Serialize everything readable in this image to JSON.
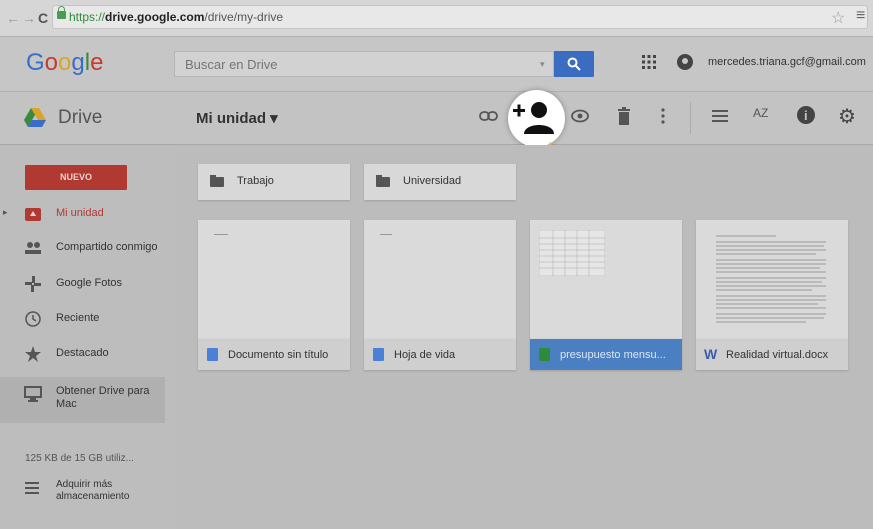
{
  "browser": {
    "url_scheme": "https://",
    "url_host": "drive.google.com",
    "url_path": "/drive/my-drive"
  },
  "header": {
    "logo_text": "Google",
    "search_placeholder": "Buscar en Drive",
    "account_email": "mercedes.triana.gcf@gmail.com"
  },
  "toolbar": {
    "app_title": "Drive",
    "location": "Mi unidad ▾",
    "sort_label": "AZ"
  },
  "sidebar": {
    "new_button": "NUEVO",
    "items": [
      {
        "label": "Mi unidad",
        "icon": "my-drive-icon"
      },
      {
        "label": "Compartido conmigo",
        "icon": "shared-icon"
      },
      {
        "label": "Google Fotos",
        "icon": "photos-icon"
      },
      {
        "label": "Reciente",
        "icon": "clock-icon"
      },
      {
        "label": "Destacado",
        "icon": "star-icon"
      }
    ],
    "obtain_drive": "Obtener Drive para Mac",
    "storage": "125 KB de 15 GB utiliz...",
    "buy_more": "Adquirir más almacenamiento"
  },
  "folders": [
    {
      "name": "Trabajo"
    },
    {
      "name": "Universidad"
    }
  ],
  "files": [
    {
      "name": "Documento sin título",
      "type": "doc",
      "color": "#4a80d8"
    },
    {
      "name": "Hoja de vida",
      "type": "doc",
      "color": "#4a80d8"
    },
    {
      "name": "presupuesto mensu...",
      "type": "sheet",
      "color": "#2e8b3a",
      "selected": true
    },
    {
      "name": "Realidad virtual.docx",
      "type": "word",
      "color": "#3b5fa8"
    }
  ],
  "colors": {
    "new_button": "#b03a32",
    "search_button": "#3a6cc1",
    "selected_file": "#4a7fc1",
    "highlight_burst": "#f2b632"
  }
}
